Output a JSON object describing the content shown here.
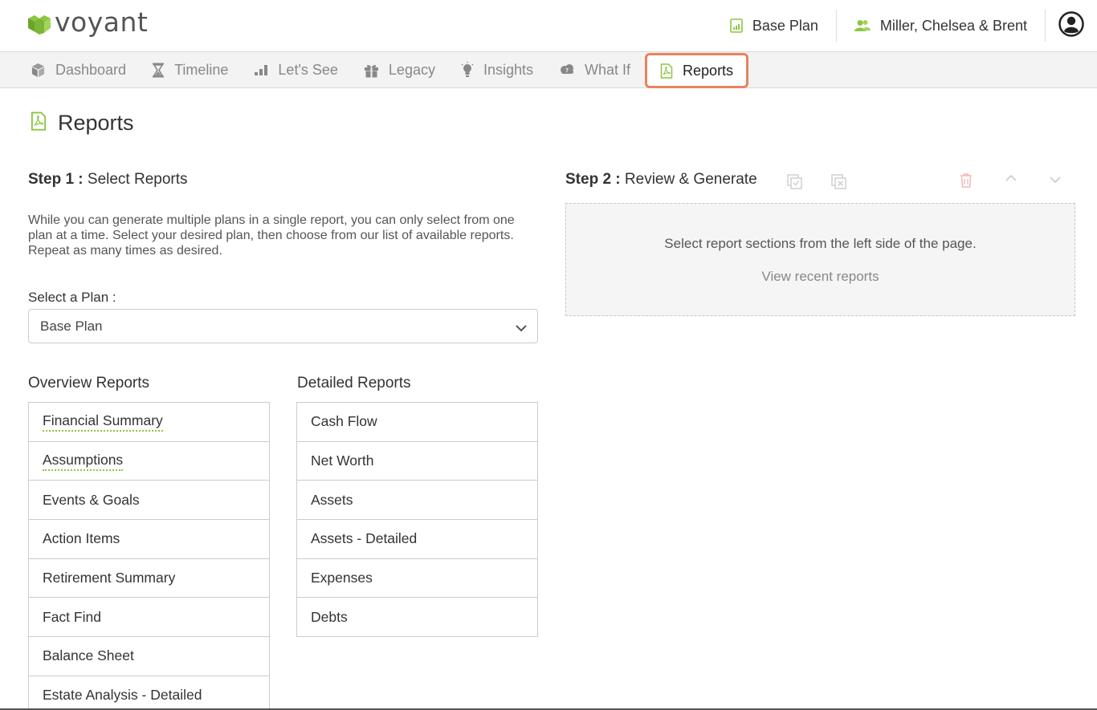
{
  "app": {
    "logo_text": "voyant",
    "brand_color": "#8cc63f"
  },
  "header": {
    "plan": "Base Plan",
    "client": "Miller, Chelsea & Brent"
  },
  "nav": {
    "items": [
      {
        "label": "Dashboard",
        "icon": "cube-icon"
      },
      {
        "label": "Timeline",
        "icon": "hourglass-icon"
      },
      {
        "label": "Let's See",
        "icon": "bar-chart-icon"
      },
      {
        "label": "Legacy",
        "icon": "gift-icon"
      },
      {
        "label": "Insights",
        "icon": "lightbulb-icon"
      },
      {
        "label": "What If",
        "icon": "cloud-icon"
      },
      {
        "label": "Reports",
        "icon": "pdf-icon",
        "active": true
      }
    ],
    "active_color": "#e9825d"
  },
  "page": {
    "title": "Reports"
  },
  "step1": {
    "prefix": "Step 1 :",
    "title": "Select Reports",
    "description": "While you can generate multiple plans in a single report, you can only select from one plan at a time. Select your desired plan, then choose from our list of available reports. Repeat as many times as desired.",
    "plan_label": "Select a Plan :",
    "plan_value": "Base Plan",
    "overview_title": "Overview Reports",
    "overview": [
      {
        "label": "Financial Summary",
        "dotted": true
      },
      {
        "label": "Assumptions",
        "dotted": true
      },
      {
        "label": "Events & Goals"
      },
      {
        "label": "Action Items"
      },
      {
        "label": "Retirement Summary"
      },
      {
        "label": "Fact Find"
      },
      {
        "label": "Balance Sheet"
      },
      {
        "label": "Estate Analysis - Detailed"
      }
    ],
    "detailed_title": "Detailed Reports",
    "detailed": [
      {
        "label": "Cash Flow"
      },
      {
        "label": "Net Worth"
      },
      {
        "label": "Assets"
      },
      {
        "label": "Assets - Detailed"
      },
      {
        "label": "Expenses"
      },
      {
        "label": "Debts"
      }
    ]
  },
  "step2": {
    "prefix": "Step 2 :",
    "title": "Review & Generate",
    "empty_message": "Select report sections from the left side of the page.",
    "recent_link": "View recent reports"
  }
}
